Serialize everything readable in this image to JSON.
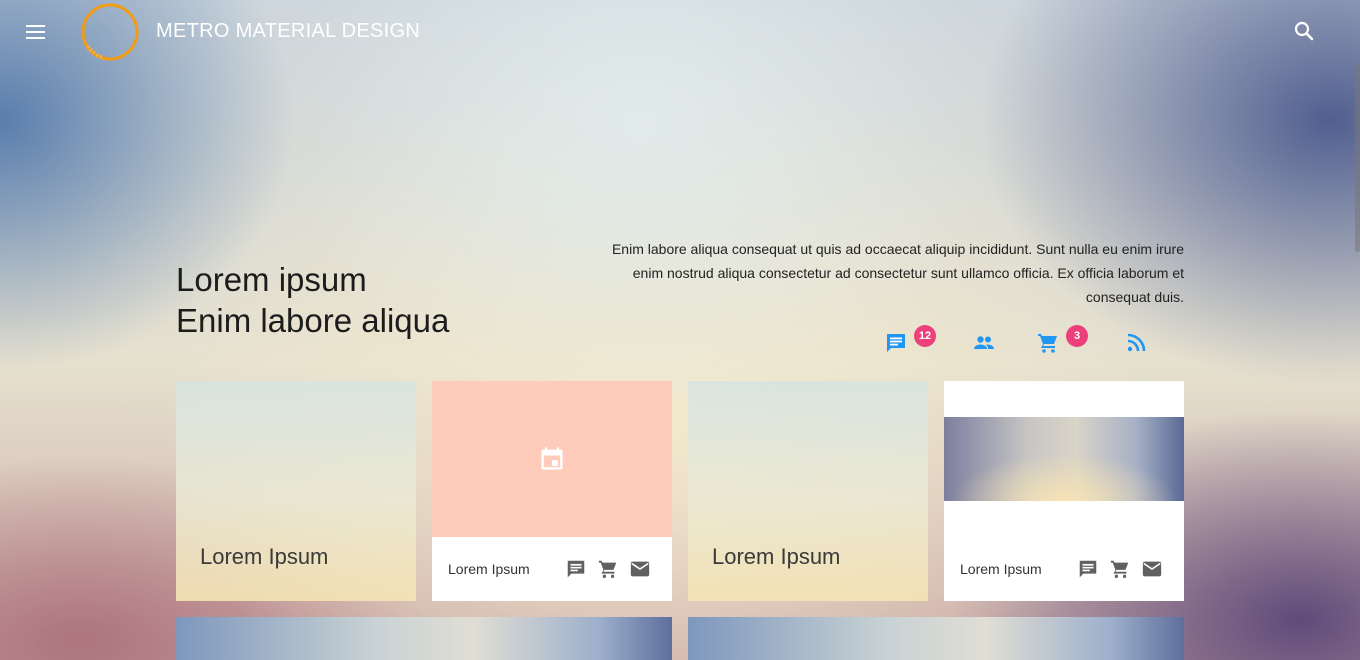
{
  "appbar": {
    "title": "METRO MATERIAL DESIGN",
    "menu_icon": "menu-icon",
    "search_icon": "search-icon"
  },
  "hero": {
    "title_line1": "Lorem ipsum",
    "title_line2": "Enim labore aliqua",
    "paragraph": "Enim labore aliqua consequat ut quis ad occaecat aliquip incididunt. Sunt nulla eu enim irure enim nostrud aliqua consectetur ad consectetur sunt ullamco officia. Ex officia laborum et consequat duis."
  },
  "actions": [
    {
      "icon": "chat-icon",
      "badge": "12"
    },
    {
      "icon": "people-icon"
    },
    {
      "icon": "cart-icon",
      "badge": "3"
    },
    {
      "icon": "rss-icon"
    }
  ],
  "tiles": {
    "tile1_label": "Lorem Ipsum",
    "tile2_label": "Lorem Ipsum",
    "tile2_icon": "calendar-icon",
    "tile3_label": "Lorem Ipsum",
    "tile4_label": "Lorem Ipsum"
  },
  "colors": {
    "accent_blue": "#2196f3",
    "badge_pink": "#ec407a",
    "tile_peach": "#ffccbc",
    "logo_orange": "#f39c12"
  }
}
